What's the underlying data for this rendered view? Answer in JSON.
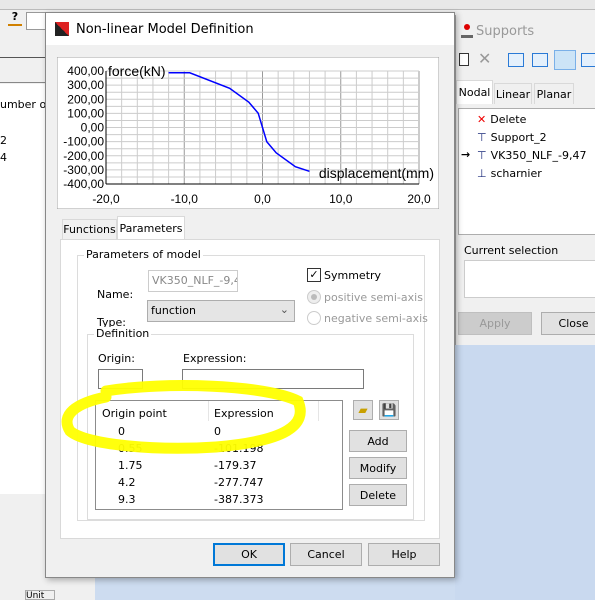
{
  "background_app": {
    "partial_text": "umber of",
    "values": [
      "2",
      "4"
    ],
    "help_icon": "help-icon",
    "bottom_tab_partial": "Unit"
  },
  "dialog": {
    "title": "Non-linear Model Definition",
    "tabs": [
      {
        "label": "Functions"
      },
      {
        "label": "Parameters",
        "active": true
      }
    ],
    "parameters_group": "Parameters of model",
    "name_label": "Name:",
    "name_value": "VK350_NLF_-9,4",
    "symmetry_label": "Symmetry",
    "symmetry_checked": true,
    "positive_semi_axis": "positive semi-axis",
    "negative_semi_axis": "negative semi-axis",
    "semi_axis_selected": "positive",
    "type_label": "Type:",
    "type_value": "function",
    "definition_group": "Definition",
    "origin_label": "Origin:",
    "origin_value": "",
    "expression_label": "Expression:",
    "expression_value": "",
    "table": {
      "headers": [
        "Origin point",
        "Expression"
      ],
      "rows": [
        [
          "0",
          "0"
        ],
        [
          "0.55",
          "-101.198"
        ],
        [
          "1.75",
          "-179.37"
        ],
        [
          "4.2",
          "-277.747"
        ],
        [
          "9.3",
          "-387.373"
        ]
      ]
    },
    "add": "Add",
    "modify": "Modify",
    "delete": "Delete",
    "ok": "OK",
    "cancel": "Cancel",
    "help": "Help",
    "highlight_color": "#ffff00"
  },
  "chart_data": {
    "type": "line",
    "xlabel": "displacement(mm)",
    "ylabel": "force(kN)",
    "xlim": [
      -20,
      20
    ],
    "ylim": [
      -400,
      400
    ],
    "x_ticks": [
      "-20,0",
      "-10,0",
      "0,0",
      "10,0",
      "20,0"
    ],
    "y_ticks": [
      "400,00",
      "300,00",
      "200,00",
      "100,00",
      "0,00",
      "-100,00",
      "-200,00",
      "-300,00",
      "-400,00"
    ],
    "grid": true,
    "color": "#0000ff",
    "x": [
      -12,
      -9.3,
      -4.2,
      -1.75,
      -0.55,
      0,
      0.55,
      1.75,
      4.2,
      6
    ],
    "y": [
      387.373,
      387.373,
      277.747,
      179.37,
      101.198,
      0,
      -101.198,
      -179.37,
      -277.747,
      -310
    ]
  },
  "supports": {
    "title": "Supports",
    "tabs": [
      "Nodal",
      "Linear",
      "Planar"
    ],
    "items": [
      {
        "label": "Delete",
        "icon": "delete-x-icon"
      },
      {
        "label": "Support_2",
        "icon": "support-icon"
      },
      {
        "label": "VK350_NLF_-9,47",
        "icon": "support-icon",
        "current": true
      },
      {
        "label": "scharnier",
        "icon": "hinge-icon"
      }
    ],
    "current_selection": "Current selection",
    "apply": "Apply",
    "close": "Close"
  }
}
